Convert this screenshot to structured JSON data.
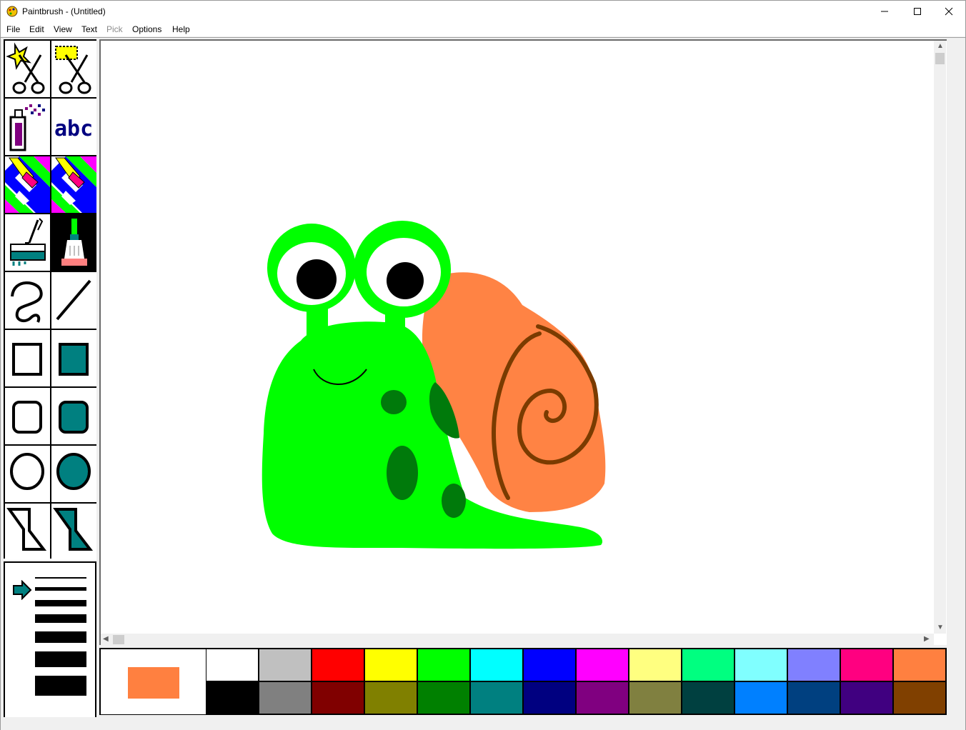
{
  "window": {
    "title": "Paintbrush - (Untitled)",
    "minimize_label": "—",
    "maximize_label": "☐",
    "close_label": "✕"
  },
  "menu": {
    "items": [
      {
        "label": "File",
        "enabled": true
      },
      {
        "label": "Edit",
        "enabled": true
      },
      {
        "label": "View",
        "enabled": true
      },
      {
        "label": "Text",
        "enabled": true
      },
      {
        "label": "Pick",
        "enabled": false
      },
      {
        "label": "Options",
        "enabled": true
      },
      {
        "label": "Help",
        "enabled": true
      }
    ]
  },
  "tools": {
    "selected": "brush",
    "items": [
      "scissors-freeform",
      "scissors-rectangle",
      "airbrush",
      "text",
      "color-eraser",
      "eraser",
      "paint-roller",
      "brush",
      "curve",
      "line",
      "box",
      "filled-box",
      "rounded-box",
      "filled-rounded-box",
      "circle",
      "filled-circle",
      "polygon",
      "filled-polygon"
    ],
    "text_tool_label": "abc"
  },
  "line_widths": {
    "selected_index": 0
  },
  "palette": {
    "foreground": "#ff8040",
    "background": "#ffffff",
    "top_row": [
      "#ffffff",
      "#c0c0c0",
      "#ff0000",
      "#ffff00",
      "#00ff00",
      "#00ffff",
      "#0000ff",
      "#ff00ff",
      "#ffff80",
      "#00ff80",
      "#80ffff",
      "#8080ff",
      "#ff0080",
      "#ff8040"
    ],
    "bottom_row": [
      "#000000",
      "#808080",
      "#800000",
      "#808000",
      "#008000",
      "#008080",
      "#000080",
      "#800080",
      "#808040",
      "#004040",
      "#0080ff",
      "#004080",
      "#400080",
      "#804000"
    ]
  },
  "drawing": {
    "colors": {
      "body": "#00ff00",
      "spots": "#007a0b",
      "shell": "#ff8344",
      "spiral": "#7a3b00",
      "eye_white": "#ffffff",
      "pupil": "#000000",
      "smile": "#000000"
    }
  }
}
